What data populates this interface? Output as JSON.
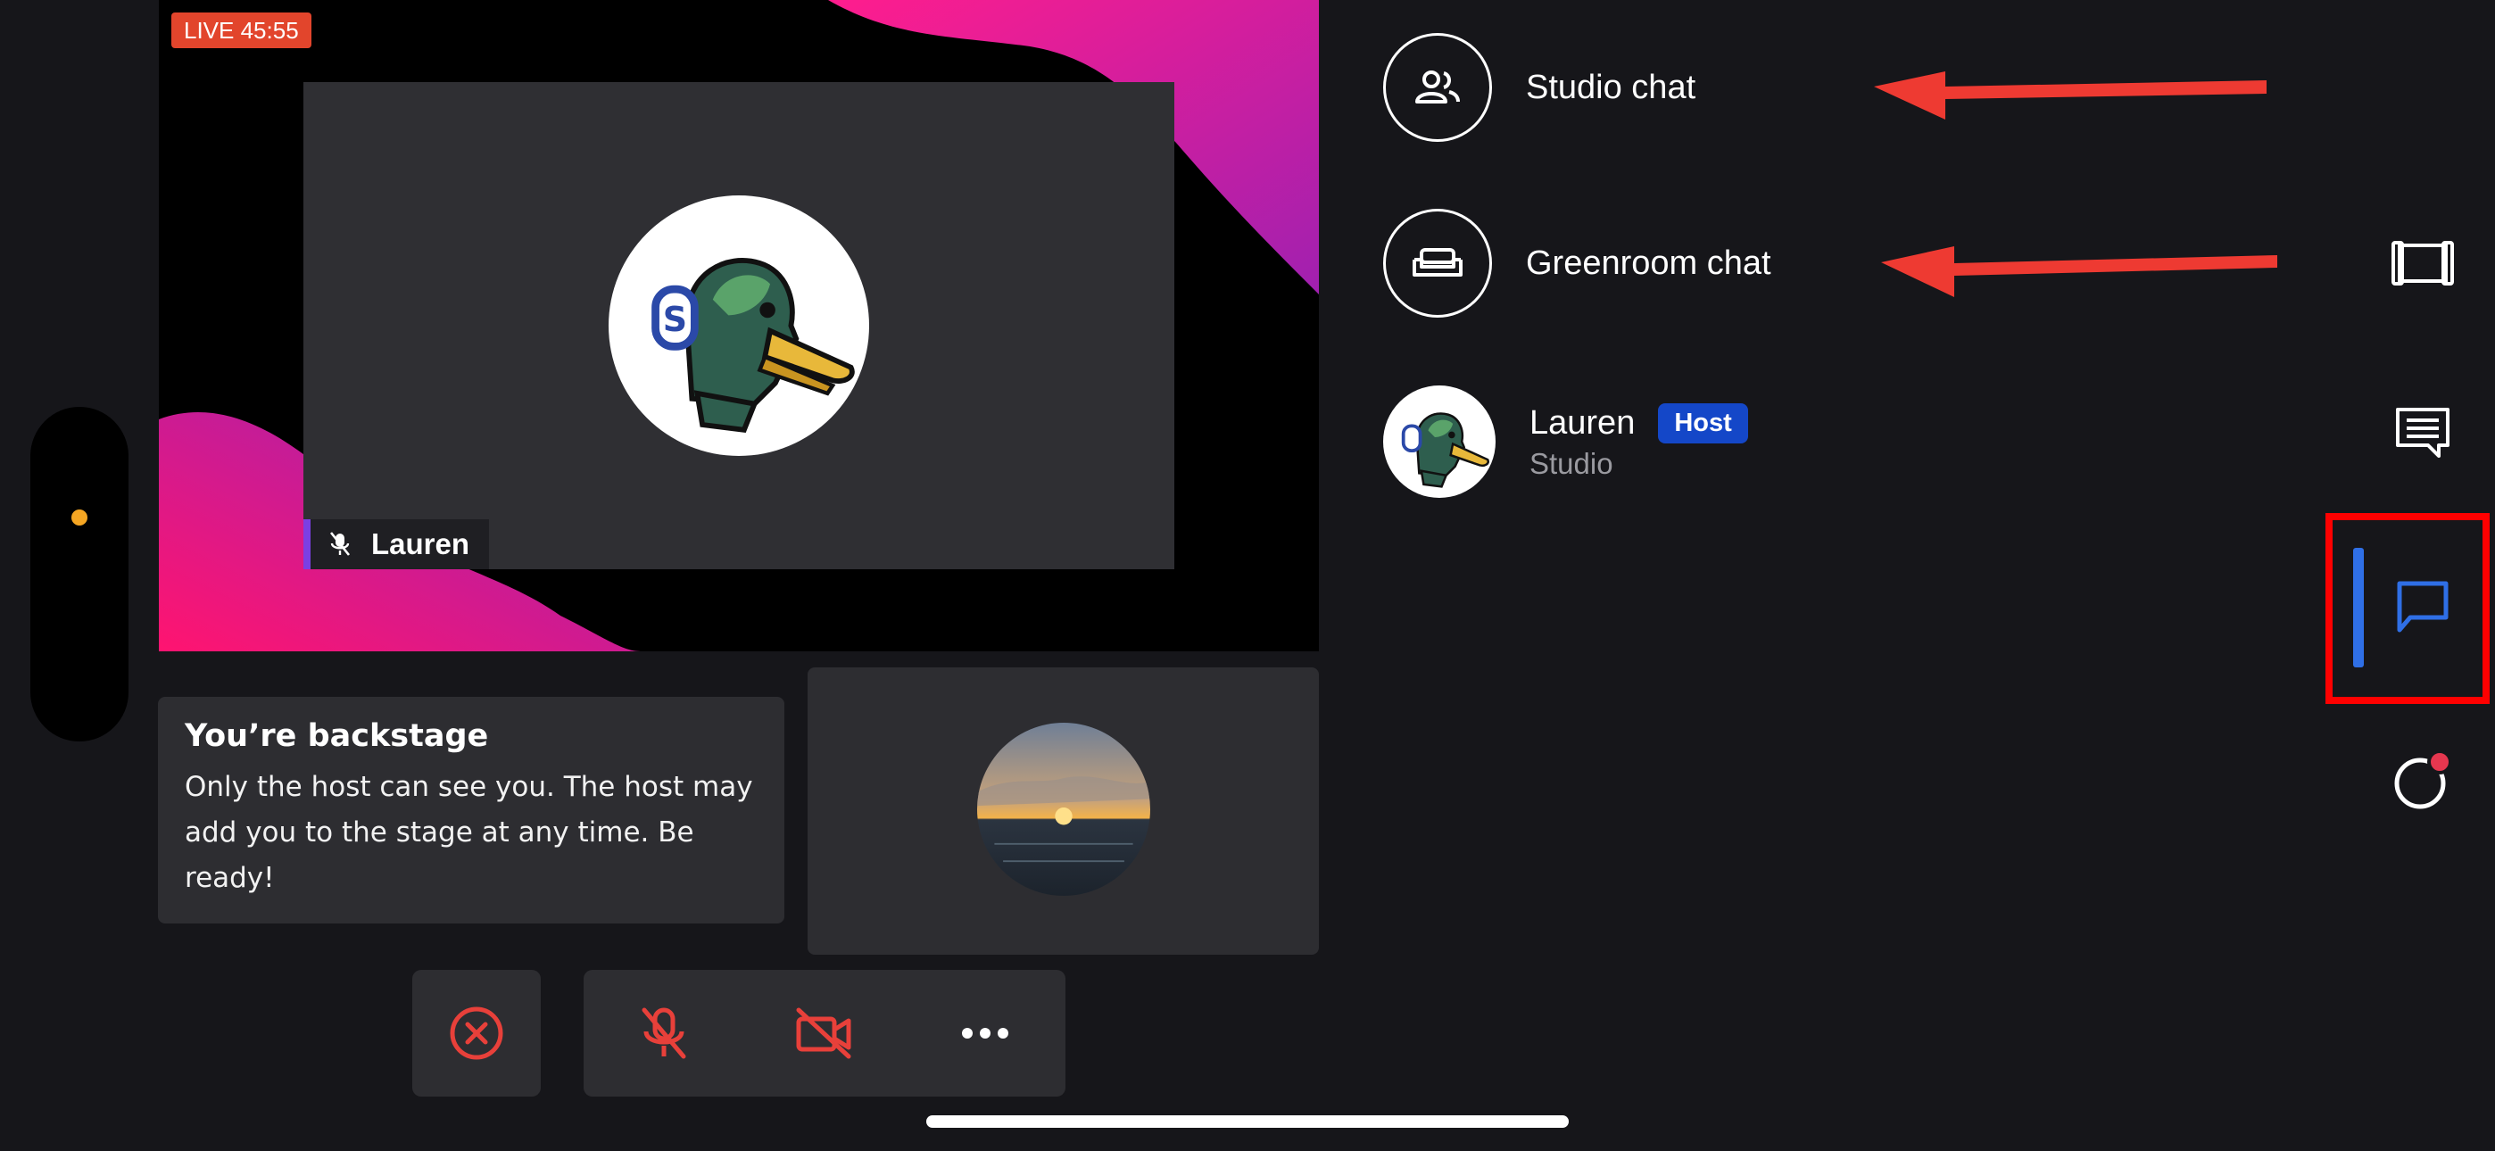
{
  "stage": {
    "live_badge": "LIVE 45:55",
    "participant_name": "Lauren"
  },
  "backstage": {
    "title": "You’re backstage",
    "message": "Only the host can see you. The host may add you to the stage at any time. Be ready!"
  },
  "chats": {
    "studio_chat": "Studio chat",
    "greenroom_chat": "Greenroom chat"
  },
  "participant": {
    "name": "Lauren",
    "role_badge": "Host",
    "location": "Studio"
  },
  "colors": {
    "accent_blue": "#2f6fe6",
    "danger_red": "#e8403a",
    "live_badge": "#e2452c",
    "host_badge": "#1447c8",
    "annotation_red": "#ff0000"
  },
  "icons": {
    "studio_chat": "users-icon",
    "greenroom_chat": "sofa-icon",
    "rail": [
      "stage-frame-icon",
      "comments-icon",
      "chat-bubble-icon",
      "record-icon"
    ],
    "controls": [
      "close-circle-icon",
      "mic-off-icon",
      "camera-off-icon",
      "more-icon"
    ]
  }
}
